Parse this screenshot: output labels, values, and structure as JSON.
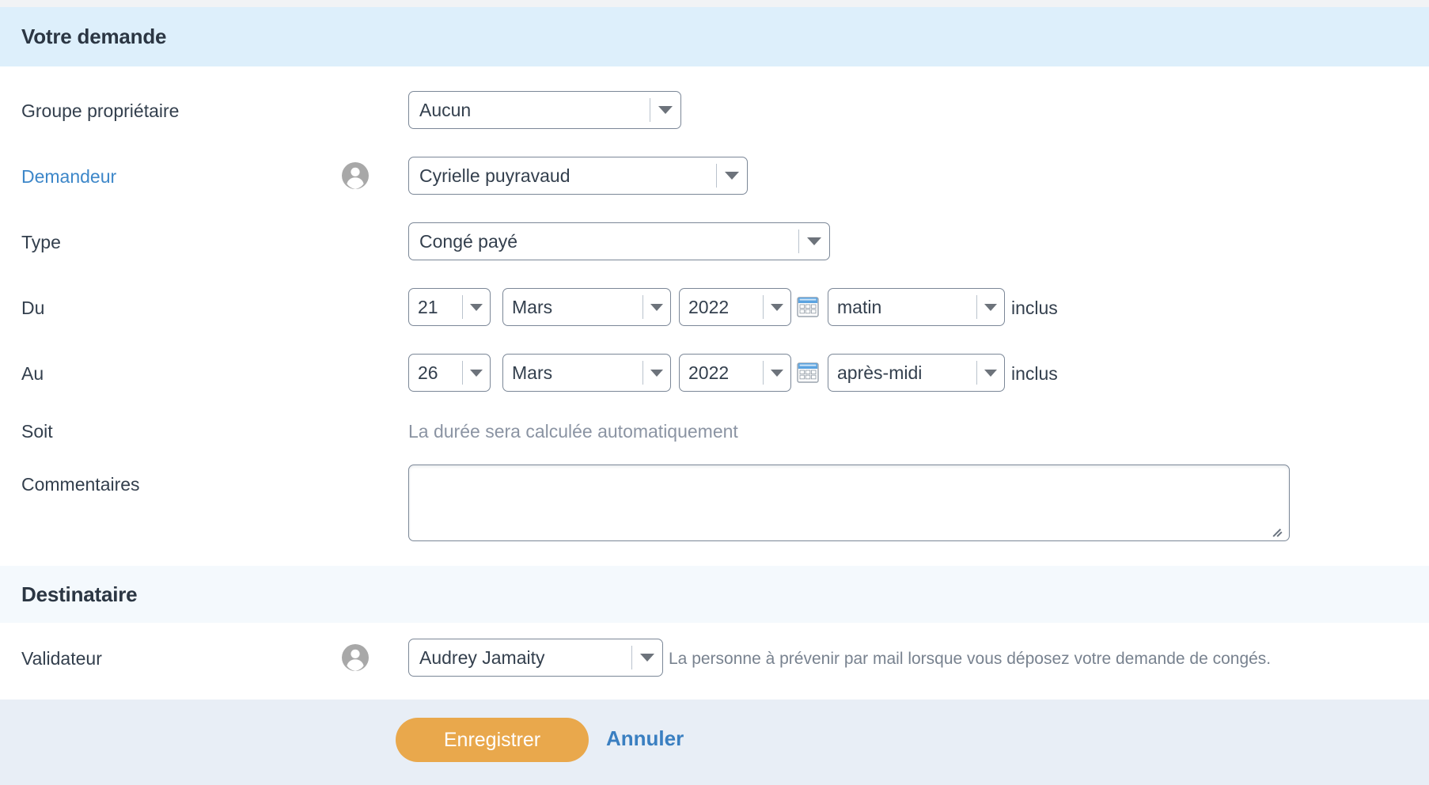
{
  "colors": {
    "primary_header_bg": "#ddeffb",
    "secondary_header_bg": "#f4f9fd",
    "footer_bg": "#e8eef6",
    "link": "#3d87c9",
    "save_button": "#e9a84c",
    "border": "#7b8797",
    "text": "#333f4d",
    "muted_text": "#8b94a3"
  },
  "sections": {
    "request": {
      "title": "Votre demande"
    },
    "recipient": {
      "title": "Destinataire"
    }
  },
  "form": {
    "owner_group": {
      "label": "Groupe propriétaire",
      "value": "Aucun"
    },
    "requester": {
      "label": "Demandeur",
      "value": "Cyrielle puyravaud",
      "icon": "person-avatar-icon"
    },
    "type": {
      "label": "Type",
      "value": "Congé payé"
    },
    "from": {
      "label": "Du",
      "day": "21",
      "month": "Mars",
      "year": "2022",
      "calendar_icon": "calendar-icon",
      "period": "matin",
      "suffix": "inclus"
    },
    "to": {
      "label": "Au",
      "day": "26",
      "month": "Mars",
      "year": "2022",
      "calendar_icon": "calendar-icon",
      "period": "après-midi",
      "suffix": "inclus"
    },
    "duration": {
      "label": "Soit",
      "value": "La durée sera calculée automatiquement"
    },
    "comments": {
      "label": "Commentaires",
      "value": "",
      "placeholder": ""
    },
    "validator": {
      "label": "Validateur",
      "value": "Audrey Jamaity",
      "icon": "person-avatar-icon",
      "hint": "La personne à prévenir par mail lorsque vous déposez votre demande de congés."
    }
  },
  "footer": {
    "save_label": "Enregistrer",
    "cancel_label": "Annuler"
  }
}
